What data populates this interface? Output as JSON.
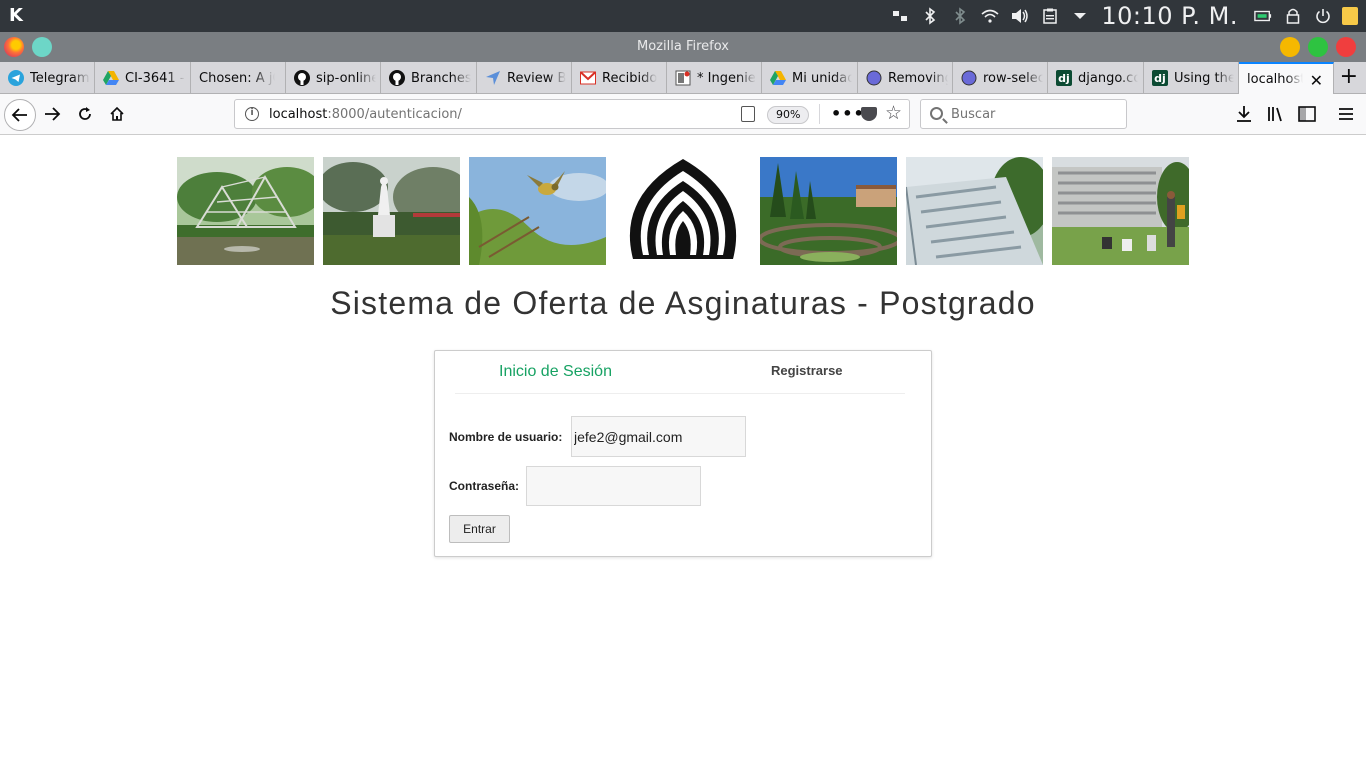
{
  "system_panel": {
    "clock": "10:10 P. M."
  },
  "window": {
    "title": "Mozilla Firefox"
  },
  "tabs": [
    {
      "label": "Telegram",
      "icon": "telegram-icon",
      "color": "#2aa3dc"
    },
    {
      "label": "CI-3641 -",
      "icon": "google-drive-icon",
      "color": "#1fa463"
    },
    {
      "label": "Chosen: A jQ",
      "icon": "none",
      "color": "#ffffff"
    },
    {
      "label": "sip-online",
      "icon": "github-icon",
      "color": "#000000"
    },
    {
      "label": "Branches",
      "icon": "github-icon",
      "color": "#000000"
    },
    {
      "label": "Review B",
      "icon": "reviewboard-icon",
      "color": "#5b8fd9"
    },
    {
      "label": "Recibido",
      "icon": "gmail-icon",
      "color": "#d93025"
    },
    {
      "label": "* Ingenie",
      "icon": "doc-icon",
      "color": "#d93025"
    },
    {
      "label": "Mi unidad",
      "icon": "google-drive-icon",
      "color": "#1fa463"
    },
    {
      "label": "Removing",
      "icon": "globe-icon",
      "color": "#5b5bd6"
    },
    {
      "label": "row-selec",
      "icon": "globe-icon",
      "color": "#5b5bd6"
    },
    {
      "label": "django.co",
      "icon": "django-icon",
      "color": "#0c4b33"
    },
    {
      "label": "Using the",
      "icon": "django-icon",
      "color": "#0c4b33"
    },
    {
      "label": "localhost",
      "icon": "none",
      "color": "#0a84ff"
    }
  ],
  "navbar": {
    "url_host": "localhost",
    "url_rest": ":8000/autenticacion/",
    "zoom": "90%",
    "search_placeholder": "Buscar"
  },
  "page": {
    "title": "Sistema de Oferta de Asginaturas - Postgrado",
    "banner_photos": [
      "sculpture-pond-photo",
      "statue-garden-photo",
      "bird-photo",
      "usb-logo",
      "campus-gardens-photo",
      "waterfall-photo",
      "library-building-photo"
    ],
    "login": {
      "tab_login": "Inicio de Sesión",
      "tab_register": "Registrarse",
      "username_label": "Nombre de usuario:",
      "username_value": "jefe2@gmail.com",
      "password_label": "Contraseña:",
      "password_value": "",
      "submit_label": "Entrar",
      "accent_color": "#17a263"
    }
  }
}
